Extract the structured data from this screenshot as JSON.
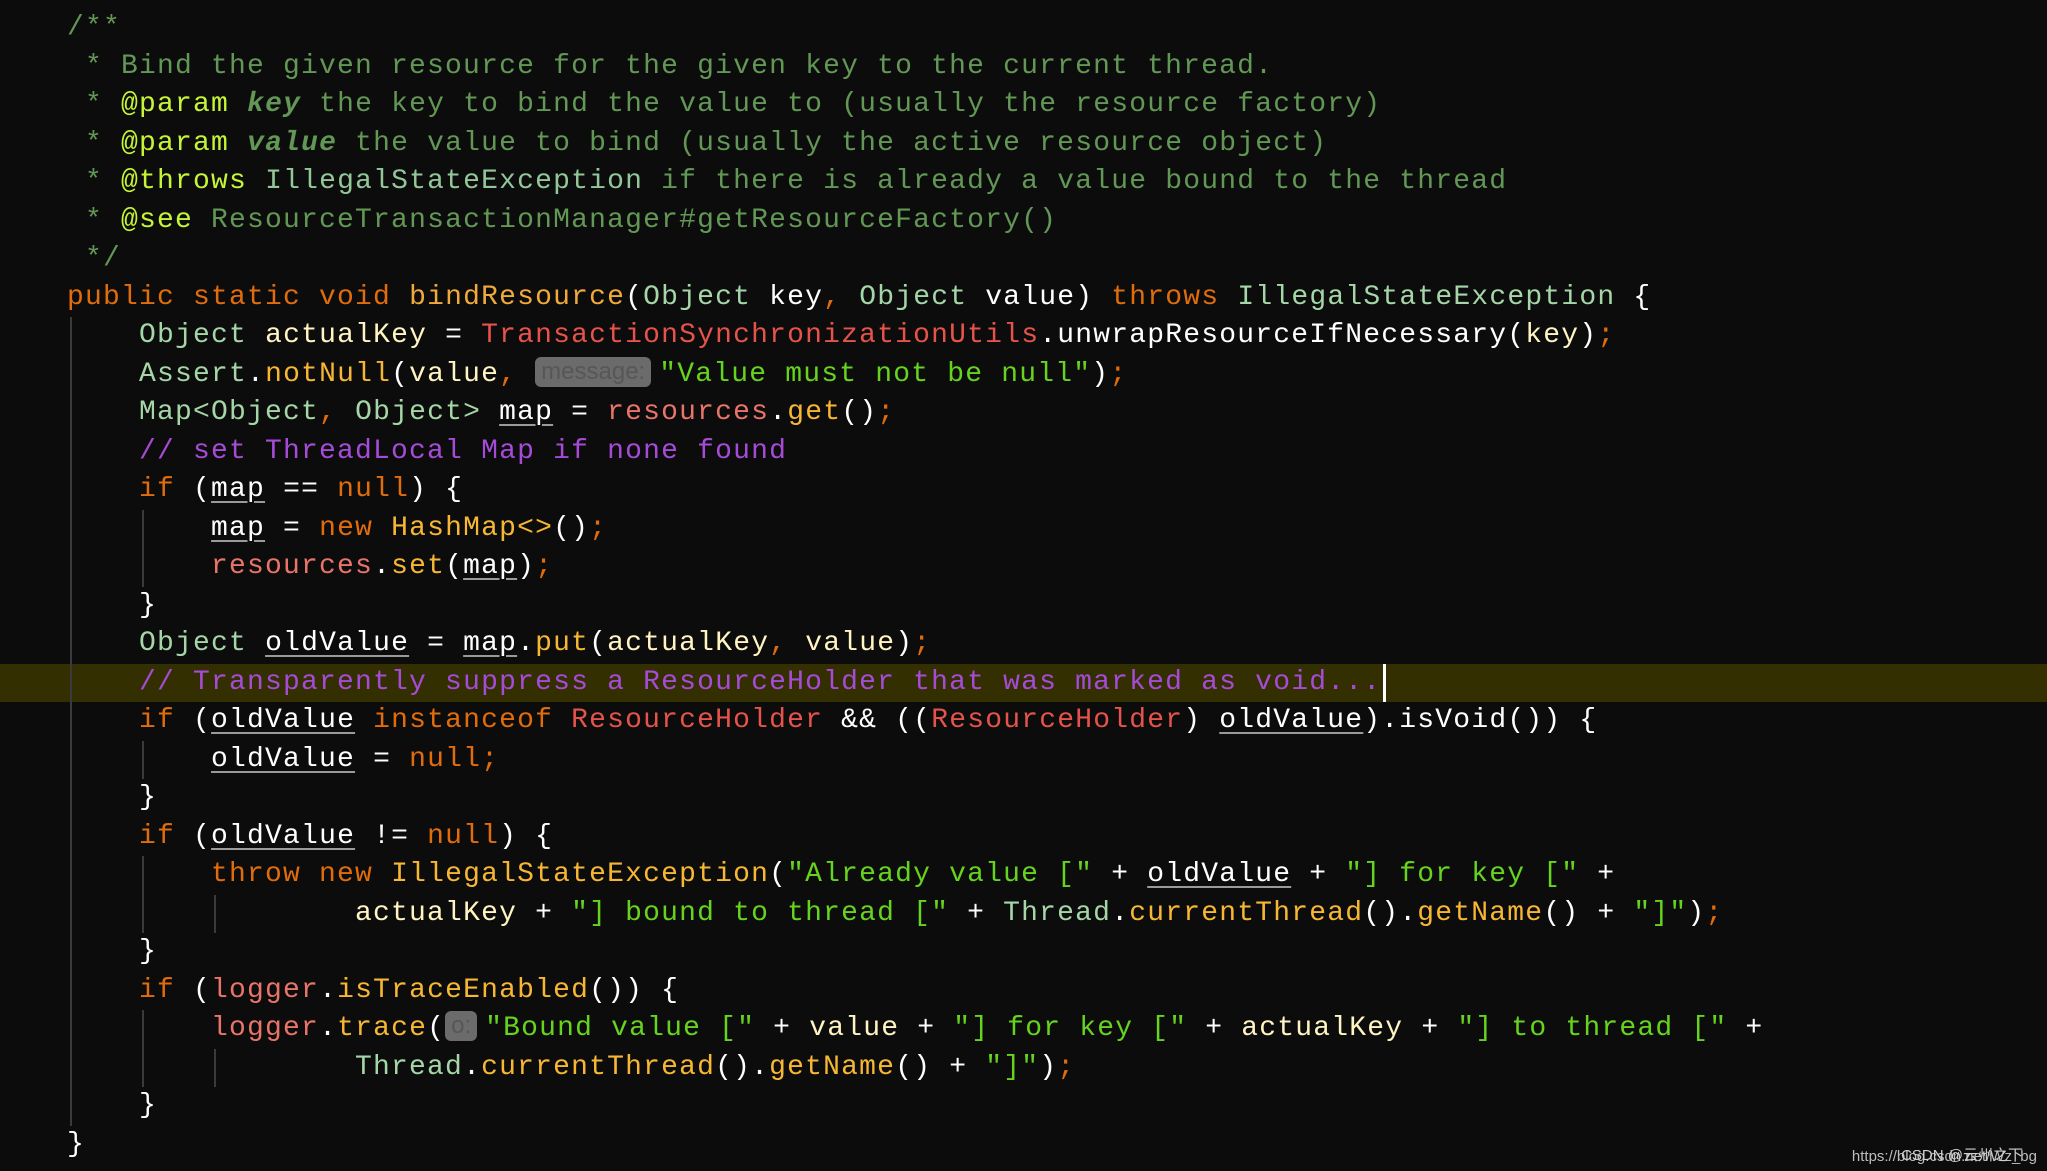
{
  "editor": {
    "theme_colors": {
      "background": "#0c0c0c",
      "current_line_highlight": "#332f00",
      "cursor": "#ffffff"
    },
    "current_line_index": 17,
    "cursor_after_text": "// Transparently suppress a ResourceHolder that was marked as void...",
    "lines": [
      [
        [
          "comment",
          "/**"
        ]
      ],
      [
        [
          "comment",
          " * Bind the given resource for the given key to the current thread."
        ]
      ],
      [
        [
          "comment",
          " * "
        ],
        [
          "doctag",
          "@param"
        ],
        [
          "comment",
          " "
        ],
        [
          "docparam",
          "key"
        ],
        [
          "comment",
          " the key to bind the value to (usually the resource factory)"
        ]
      ],
      [
        [
          "comment",
          " * "
        ],
        [
          "doctag",
          "@param"
        ],
        [
          "comment",
          " "
        ],
        [
          "docparam",
          "value"
        ],
        [
          "comment",
          " the value to bind (usually the active resource object)"
        ]
      ],
      [
        [
          "comment",
          " * "
        ],
        [
          "doctag",
          "@throws"
        ],
        [
          "comment",
          " "
        ],
        [
          "doclink",
          "IllegalStateException"
        ],
        [
          "comment",
          " if there is already a value bound to the thread"
        ]
      ],
      [
        [
          "comment",
          " * "
        ],
        [
          "doctag",
          "@see"
        ],
        [
          "comment",
          " ResourceTransactionManager#getResourceFactory()"
        ]
      ],
      [
        [
          "comment",
          " */"
        ]
      ],
      [
        [
          "keyword",
          "public static void "
        ],
        [
          "method-decl",
          "bindResource"
        ],
        [
          "plain",
          "("
        ],
        [
          "type",
          "Object"
        ],
        [
          "plain",
          " "
        ],
        [
          "param",
          "key"
        ],
        [
          "punct",
          ","
        ],
        [
          "plain",
          " "
        ],
        [
          "type",
          "Object"
        ],
        [
          "plain",
          " "
        ],
        [
          "param",
          "value"
        ],
        [
          "plain",
          ") "
        ],
        [
          "keyword",
          "throws "
        ],
        [
          "type",
          "IllegalStateException"
        ],
        [
          "plain",
          " {"
        ]
      ],
      [
        [
          "plain",
          "    "
        ],
        [
          "type",
          "Object"
        ],
        [
          "plain",
          " "
        ],
        [
          "local",
          "actualKey"
        ],
        [
          "plain",
          " = "
        ],
        [
          "static-class",
          "TransactionSynchronizationUtils"
        ],
        [
          "plain",
          ".unwrapResourceIfNecessary("
        ],
        [
          "local",
          "key"
        ],
        [
          "plain",
          ")"
        ],
        [
          "punct",
          ";"
        ]
      ],
      [
        [
          "plain",
          "    "
        ],
        [
          "type",
          "Assert"
        ],
        [
          "plain",
          "."
        ],
        [
          "method",
          "notNull"
        ],
        [
          "plain",
          "("
        ],
        [
          "local",
          "value"
        ],
        [
          "punct",
          ","
        ],
        [
          "plain",
          " "
        ],
        [
          "hint",
          "message:"
        ],
        [
          "string",
          "\"Value must not be null\""
        ],
        [
          "plain",
          ")"
        ],
        [
          "punct",
          ";"
        ]
      ],
      [
        [
          "plain",
          "    "
        ],
        [
          "type",
          "Map<Object"
        ],
        [
          "punct",
          ","
        ],
        [
          "plain",
          " "
        ],
        [
          "type",
          "Object>"
        ],
        [
          "plain",
          " "
        ],
        [
          "underline",
          "map"
        ],
        [
          "plain",
          " = "
        ],
        [
          "field",
          "resources"
        ],
        [
          "plain",
          "."
        ],
        [
          "method",
          "get"
        ],
        [
          "plain",
          "()"
        ],
        [
          "punct",
          ";"
        ]
      ],
      [
        [
          "plain",
          "    "
        ],
        [
          "linecomment",
          "// set ThreadLocal Map if none found"
        ]
      ],
      [
        [
          "plain",
          "    "
        ],
        [
          "keyword",
          "if"
        ],
        [
          "plain",
          " ("
        ],
        [
          "underline",
          "map"
        ],
        [
          "plain",
          " == "
        ],
        [
          "keyword",
          "null"
        ],
        [
          "plain",
          ") {"
        ]
      ],
      [
        [
          "plain",
          "        "
        ],
        [
          "underline",
          "map"
        ],
        [
          "plain",
          " = "
        ],
        [
          "keyword",
          "new "
        ],
        [
          "method",
          "HashMap<>"
        ],
        [
          "plain",
          "()"
        ],
        [
          "punct",
          ";"
        ]
      ],
      [
        [
          "plain",
          "        "
        ],
        [
          "field",
          "resources"
        ],
        [
          "plain",
          "."
        ],
        [
          "method",
          "set"
        ],
        [
          "plain",
          "("
        ],
        [
          "underline",
          "map"
        ],
        [
          "plain",
          ")"
        ],
        [
          "punct",
          ";"
        ]
      ],
      [
        [
          "plain",
          "    }"
        ]
      ],
      [
        [
          "plain",
          "    "
        ],
        [
          "type",
          "Object"
        ],
        [
          "plain",
          " "
        ],
        [
          "underline",
          "oldValue"
        ],
        [
          "plain",
          " = "
        ],
        [
          "underline",
          "map"
        ],
        [
          "plain",
          "."
        ],
        [
          "method",
          "put"
        ],
        [
          "plain",
          "("
        ],
        [
          "local",
          "actualKey"
        ],
        [
          "punct",
          ","
        ],
        [
          "plain",
          " "
        ],
        [
          "local",
          "value"
        ],
        [
          "plain",
          ")"
        ],
        [
          "punct",
          ";"
        ]
      ],
      [
        [
          "plain",
          "    "
        ],
        [
          "linecomment",
          "// Transparently suppress a ResourceHolder that was marked as void..."
        ]
      ],
      [
        [
          "plain",
          "    "
        ],
        [
          "keyword",
          "if"
        ],
        [
          "plain",
          " ("
        ],
        [
          "underline",
          "oldValue"
        ],
        [
          "plain",
          " "
        ],
        [
          "keyword",
          "instanceof "
        ],
        [
          "static-class",
          "ResourceHolder"
        ],
        [
          "plain",
          " && (("
        ],
        [
          "static-class",
          "ResourceHolder"
        ],
        [
          "plain",
          ") "
        ],
        [
          "underline",
          "oldValue"
        ],
        [
          "plain",
          ").isVoid()) {"
        ]
      ],
      [
        [
          "plain",
          "        "
        ],
        [
          "underline",
          "oldValue"
        ],
        [
          "plain",
          " = "
        ],
        [
          "keyword",
          "null"
        ],
        [
          "punct",
          ";"
        ]
      ],
      [
        [
          "plain",
          "    }"
        ]
      ],
      [
        [
          "plain",
          "    "
        ],
        [
          "keyword",
          "if"
        ],
        [
          "plain",
          " ("
        ],
        [
          "underline",
          "oldValue"
        ],
        [
          "plain",
          " != "
        ],
        [
          "keyword",
          "null"
        ],
        [
          "plain",
          ") {"
        ]
      ],
      [
        [
          "plain",
          "        "
        ],
        [
          "keyword",
          "throw new "
        ],
        [
          "method",
          "IllegalStateException"
        ],
        [
          "plain",
          "("
        ],
        [
          "string",
          "\"Already value [\""
        ],
        [
          "plain",
          " + "
        ],
        [
          "underline",
          "oldValue"
        ],
        [
          "plain",
          " + "
        ],
        [
          "string",
          "\"] for key [\""
        ],
        [
          "plain",
          " +"
        ]
      ],
      [
        [
          "plain",
          "                "
        ],
        [
          "local",
          "actualKey"
        ],
        [
          "plain",
          " + "
        ],
        [
          "string",
          "\"] bound to thread [\""
        ],
        [
          "plain",
          " + "
        ],
        [
          "type",
          "Thread"
        ],
        [
          "plain",
          "."
        ],
        [
          "method",
          "currentThread"
        ],
        [
          "plain",
          "()."
        ],
        [
          "method",
          "getName"
        ],
        [
          "plain",
          "() + "
        ],
        [
          "string",
          "\"]\""
        ],
        [
          "plain",
          ")"
        ],
        [
          "punct",
          ";"
        ]
      ],
      [
        [
          "plain",
          "    }"
        ]
      ],
      [
        [
          "plain",
          "    "
        ],
        [
          "keyword",
          "if"
        ],
        [
          "plain",
          " ("
        ],
        [
          "field",
          "logger"
        ],
        [
          "plain",
          "."
        ],
        [
          "method",
          "isTraceEnabled"
        ],
        [
          "plain",
          "()) {"
        ]
      ],
      [
        [
          "plain",
          "        "
        ],
        [
          "field",
          "logger"
        ],
        [
          "plain",
          "."
        ],
        [
          "method",
          "trace"
        ],
        [
          "plain",
          "("
        ],
        [
          "hint",
          "o:"
        ],
        [
          "string",
          "\"Bound value [\""
        ],
        [
          "plain",
          " + "
        ],
        [
          "local",
          "value"
        ],
        [
          "plain",
          " + "
        ],
        [
          "string",
          "\"] for key [\""
        ],
        [
          "plain",
          " + "
        ],
        [
          "local",
          "actualKey"
        ],
        [
          "plain",
          " + "
        ],
        [
          "string",
          "\"] to thread [\""
        ],
        [
          "plain",
          " +"
        ]
      ],
      [
        [
          "plain",
          "                "
        ],
        [
          "type",
          "Thread"
        ],
        [
          "plain",
          "."
        ],
        [
          "method",
          "currentThread"
        ],
        [
          "plain",
          "()."
        ],
        [
          "method",
          "getName"
        ],
        [
          "plain",
          "() + "
        ],
        [
          "string",
          "\"]\""
        ],
        [
          "plain",
          ")"
        ],
        [
          "punct",
          ";"
        ]
      ],
      [
        [
          "plain",
          "    }"
        ]
      ],
      [
        [
          "plain",
          "}"
        ]
      ]
    ]
  },
  "watermark": {
    "url": "https://blog.csdn.net/Wz_bg",
    "author": "CSDN @云州之下"
  }
}
